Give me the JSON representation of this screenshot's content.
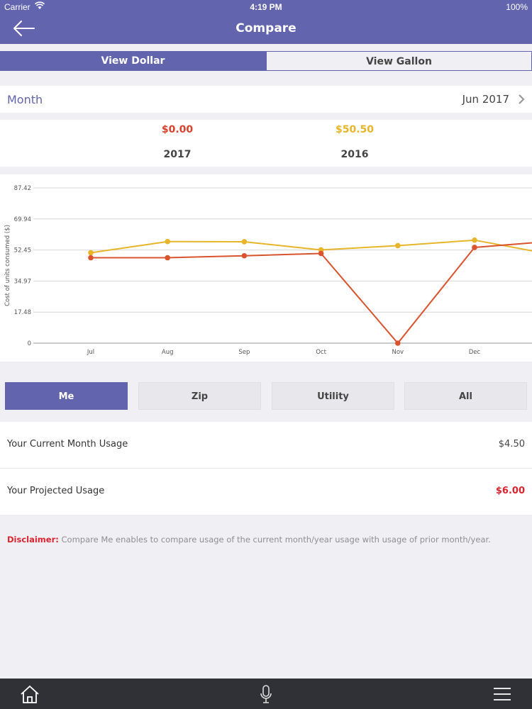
{
  "status_bar": {
    "carrier": "Carrier",
    "time": "4:19 PM",
    "battery": "100%"
  },
  "nav": {
    "title": "Compare"
  },
  "segments": {
    "dollar": "View Dollar",
    "gallon": "View Gallon",
    "selected": "dollar"
  },
  "month": {
    "label": "Month",
    "value": "Jun 2017"
  },
  "comparison": [
    {
      "amount": "$0.00",
      "year": "2017",
      "color": "#d9432e"
    },
    {
      "amount": "$50.50",
      "year": "2016",
      "color": "#e8b52a"
    }
  ],
  "chart_data": {
    "type": "line",
    "ylabel": "Cost of units consumed ($)",
    "y_ticks": [
      "0",
      "17.48",
      "34.97",
      "52.45",
      "69.94",
      "87.42"
    ],
    "ylim": [
      0,
      87.42
    ],
    "categories": [
      "Jul",
      "Aug",
      "Sep",
      "Oct",
      "Nov",
      "Dec"
    ],
    "grid": true,
    "series": [
      {
        "color": "#e8b52a",
        "values": [
          50.9,
          57.2,
          57.1,
          52.5,
          54.9,
          58.0
        ],
        "extends_to": 52.0
      },
      {
        "color": "#d9532e",
        "values": [
          48.1,
          48.1,
          49.2,
          50.5,
          0.0,
          53.9
        ],
        "extends_to": 56.5
      }
    ]
  },
  "filters": {
    "me": "Me",
    "zip": "Zip",
    "utility": "Utility",
    "all": "All",
    "selected": "me"
  },
  "usage": {
    "current_label": "Your Current Month Usage",
    "current_value": "$4.50",
    "projected_label": "Your Projected Usage",
    "projected_value": "$6.00"
  },
  "disclaimer": {
    "label": "Disclaimer:",
    "text": "Compare Me enables to compare usage of the current month/year usage with usage of prior month/year."
  },
  "tabbar": {
    "icons": [
      "home-icon",
      "microphone-icon",
      "menu-icon"
    ]
  }
}
